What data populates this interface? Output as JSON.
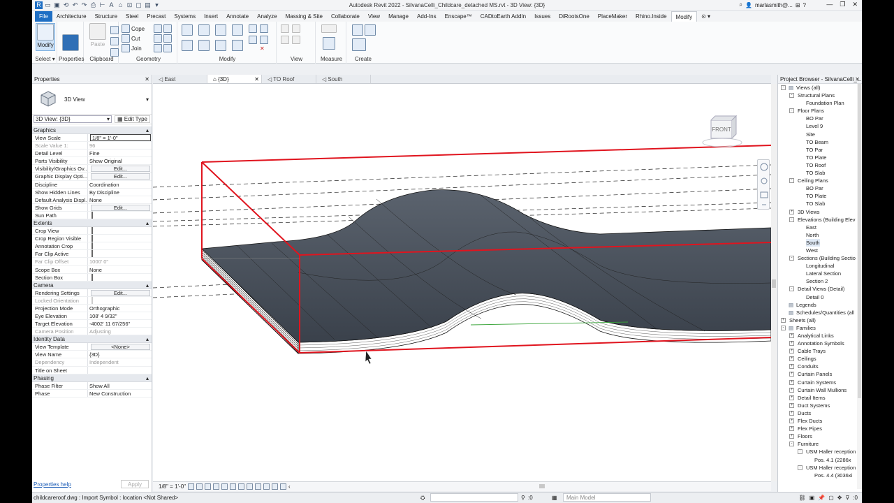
{
  "window": {
    "title": "Autodesk Revit 2022 - SilvanaCelli_Childcare_detached MS.rvt - 3D View: {3D}",
    "user": "marlasmith@..."
  },
  "tabs": [
    "File",
    "Architecture",
    "Structure",
    "Steel",
    "Precast",
    "Systems",
    "Insert",
    "Annotate",
    "Analyze",
    "Massing & Site",
    "Collaborate",
    "View",
    "Manage",
    "Add-Ins",
    "Enscape™",
    "CADtoEarth AddIn",
    "Issues",
    "DiRootsOne",
    "PlaceMaker",
    "Rhino.Inside",
    "Modify"
  ],
  "active_tab": "Modify",
  "ribbon": {
    "select": {
      "button": "Modify",
      "label": "Select ▾"
    },
    "properties": {
      "button": "Properties",
      "label": "Properties"
    },
    "clipboard": {
      "paste": "Paste",
      "label": "Clipboard"
    },
    "geometry": {
      "cope": "Cope",
      "cut": "Cut",
      "join": "Join",
      "label": "Geometry"
    },
    "modify_label": "Modify",
    "view_label": "View",
    "measure_label": "Measure",
    "create_label": "Create"
  },
  "properties_panel": {
    "title": "Properties",
    "type_name": "3D View",
    "filter": "3D View: {3D}",
    "edit_type": "Edit Type",
    "groups": [
      {
        "name": "Graphics",
        "rows": [
          {
            "k": "View Scale",
            "v": "1/8\" = 1'-0\"",
            "t": "inp"
          },
          {
            "k": "Scale Value    1:",
            "v": "96",
            "t": "dis"
          },
          {
            "k": "Detail Level",
            "v": "Fine"
          },
          {
            "k": "Parts Visibility",
            "v": "Show Original"
          },
          {
            "k": "Visibility/Graphics Ov...",
            "v": "Edit...",
            "t": "btn"
          },
          {
            "k": "Graphic Display Opti...",
            "v": "Edit...",
            "t": "btn"
          },
          {
            "k": "Discipline",
            "v": "Coordination"
          },
          {
            "k": "Show Hidden Lines",
            "v": "By Discipline"
          },
          {
            "k": "Default Analysis Displ...",
            "v": "None"
          },
          {
            "k": "Show Grids",
            "v": "Edit...",
            "t": "btn"
          },
          {
            "k": "Sun Path",
            "v": "",
            "t": "chk"
          }
        ]
      },
      {
        "name": "Extents",
        "rows": [
          {
            "k": "Crop View",
            "v": "",
            "t": "chk"
          },
          {
            "k": "Crop Region Visible",
            "v": "",
            "t": "chk"
          },
          {
            "k": "Annotation Crop",
            "v": "",
            "t": "chk"
          },
          {
            "k": "Far Clip Active",
            "v": "",
            "t": "chk"
          },
          {
            "k": "Far Clip Offset",
            "v": "1000'  0\"",
            "t": "dis"
          },
          {
            "k": "Scope Box",
            "v": "None"
          },
          {
            "k": "Section Box",
            "v": "",
            "t": "chk"
          }
        ]
      },
      {
        "name": "Camera",
        "rows": [
          {
            "k": "Rendering Settings",
            "v": "Edit...",
            "t": "btn"
          },
          {
            "k": "Locked Orientation",
            "v": "",
            "t": "dischk"
          },
          {
            "k": "Projection Mode",
            "v": "Orthographic"
          },
          {
            "k": "Eye Elevation",
            "v": "108'  4 9/32\""
          },
          {
            "k": "Target Elevation",
            "v": "-4002'  11 67/256\""
          },
          {
            "k": "Camera Position",
            "v": "Adjusting",
            "t": "dis"
          }
        ]
      },
      {
        "name": "Identity Data",
        "rows": [
          {
            "k": "View Template",
            "v": "<None>",
            "t": "btn"
          },
          {
            "k": "View Name",
            "v": "{3D}"
          },
          {
            "k": "Dependency",
            "v": "Independent",
            "t": "dis"
          },
          {
            "k": "Title on Sheet",
            "v": ""
          }
        ]
      },
      {
        "name": "Phasing",
        "rows": [
          {
            "k": "Phase Filter",
            "v": "Show All"
          },
          {
            "k": "Phase",
            "v": "New Construction"
          }
        ]
      }
    ],
    "help": "Properties help",
    "apply": "Apply"
  },
  "view_tabs": [
    {
      "label": "East",
      "active": false,
      "close": false
    },
    {
      "label": "{3D}",
      "active": true,
      "close": true
    },
    {
      "label": "TO Roof",
      "active": false,
      "close": false
    },
    {
      "label": "South",
      "active": false,
      "close": false
    }
  ],
  "viewcube": "FRONT",
  "view_bar": {
    "scale": "1/8\" = 1'-0\""
  },
  "project_browser": {
    "title": "Project Browser - SilvanaCelli_...",
    "nodes": [
      {
        "d": 0,
        "t": "-",
        "l": "Views (all)",
        "i": true
      },
      {
        "d": 1,
        "t": "-",
        "l": "Structural Plans"
      },
      {
        "d": 2,
        "l": "Foundation Plan"
      },
      {
        "d": 1,
        "t": "-",
        "l": "Floor Plans"
      },
      {
        "d": 2,
        "l": "BO Par"
      },
      {
        "d": 2,
        "l": "Level 9"
      },
      {
        "d": 2,
        "l": "Site"
      },
      {
        "d": 2,
        "l": "TO Beam"
      },
      {
        "d": 2,
        "l": "TO Par"
      },
      {
        "d": 2,
        "l": "TO Plate"
      },
      {
        "d": 2,
        "l": "TO Roof"
      },
      {
        "d": 2,
        "l": "TO Slab"
      },
      {
        "d": 1,
        "t": "-",
        "l": "Ceiling Plans"
      },
      {
        "d": 2,
        "l": "BO Par"
      },
      {
        "d": 2,
        "l": "TO Plate"
      },
      {
        "d": 2,
        "l": "TO Slab"
      },
      {
        "d": 1,
        "t": "+",
        "l": "3D Views"
      },
      {
        "d": 1,
        "t": "-",
        "l": "Elevations (Building Elev"
      },
      {
        "d": 2,
        "l": "East"
      },
      {
        "d": 2,
        "l": "North"
      },
      {
        "d": 2,
        "l": "South",
        "s": true
      },
      {
        "d": 2,
        "l": "West"
      },
      {
        "d": 1,
        "t": "-",
        "l": "Sections (Building Sectio"
      },
      {
        "d": 2,
        "l": "Longitudinal"
      },
      {
        "d": 2,
        "l": "Lateral Section"
      },
      {
        "d": 2,
        "l": "Section 2"
      },
      {
        "d": 1,
        "t": "-",
        "l": "Detail Views (Detail)"
      },
      {
        "d": 2,
        "l": "Detail 0"
      },
      {
        "d": 0,
        "l": "Legends",
        "i": true
      },
      {
        "d": 0,
        "l": "Schedules/Quantities (all",
        "i": true
      },
      {
        "d": 0,
        "t": "+",
        "l": "Sheets (all)"
      },
      {
        "d": 0,
        "t": "-",
        "l": "Families",
        "i": true
      },
      {
        "d": 1,
        "t": "+",
        "l": "Analytical Links"
      },
      {
        "d": 1,
        "t": "+",
        "l": "Annotation Symbols"
      },
      {
        "d": 1,
        "t": "+",
        "l": "Cable Trays"
      },
      {
        "d": 1,
        "t": "+",
        "l": "Ceilings"
      },
      {
        "d": 1,
        "t": "+",
        "l": "Conduits"
      },
      {
        "d": 1,
        "t": "+",
        "l": "Curtain Panels"
      },
      {
        "d": 1,
        "t": "+",
        "l": "Curtain Systems"
      },
      {
        "d": 1,
        "t": "+",
        "l": "Curtain Wall Mullions"
      },
      {
        "d": 1,
        "t": "+",
        "l": "Detail Items"
      },
      {
        "d": 1,
        "t": "+",
        "l": "Duct Systems"
      },
      {
        "d": 1,
        "t": "+",
        "l": "Ducts"
      },
      {
        "d": 1,
        "t": "+",
        "l": "Flex Ducts"
      },
      {
        "d": 1,
        "t": "+",
        "l": "Flex Pipes"
      },
      {
        "d": 1,
        "t": "+",
        "l": "Floors"
      },
      {
        "d": 1,
        "t": "-",
        "l": "Furniture"
      },
      {
        "d": 2,
        "t": "-",
        "l": "USM Haller reception"
      },
      {
        "d": 3,
        "l": "Pos. 4.1  (2286x"
      },
      {
        "d": 2,
        "t": "-",
        "l": "USM Haller reception"
      },
      {
        "d": 3,
        "l": "Pos. 4.4  (3036xi"
      }
    ]
  },
  "status_bar": {
    "text": "childcareroof.dwg : Import Symbol : location <Not Shared>",
    "model": "Main Model",
    "zero": ":0"
  }
}
